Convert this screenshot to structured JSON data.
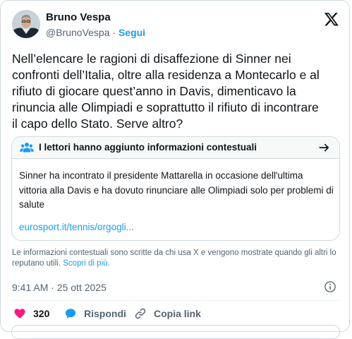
{
  "author": {
    "name": "Bruno Vespa",
    "handle": "@BrunoVespa",
    "separator": "·",
    "follow_label": "Segui"
  },
  "tweet": {
    "text": "Nell’elencare le ragioni di disaffezione di Sinner nei\nconfronti dell’Italia, oltre alla residenza a Montecarlo e al\nrifiuto di giocare quest’anno in Davis, dimenticavo la\nrinuncia alle Olimpiadi e soprattutto il rifiuto di incontrare\nil capo dello Stato. Serve altro?"
  },
  "community_note": {
    "title": "I lettori hanno aggiunto informazioni contestuali",
    "body": "Sinner ha incontrato il presidente Mattarella in occasione dell'ultima vittoria alla Davis e ha dovuto rinunciare alle Olimpiadi solo per problemi di salute",
    "link": "eurosport.it/tennis/orgogli..."
  },
  "disclaimer": {
    "text": "Le informazioni contestuali sono scritte da chi usa X e vengono mostrate quando gli altri lo reputano utili. ",
    "learn_more": "Scopri di più."
  },
  "meta": {
    "timestamp": "9:41 AM · 25 ott 2025"
  },
  "actions": {
    "like_count": "320",
    "reply_label": "Rispondi",
    "copy_label": "Copia link"
  },
  "icons": {
    "x_logo": "x-logo-icon",
    "people": "people-icon",
    "arrow": "arrow-right-icon",
    "info": "info-icon",
    "heart": "heart-icon",
    "reply": "chat-bubble-icon",
    "link": "link-icon"
  },
  "colors": {
    "accent": "#1d9bf0",
    "like": "#f91880",
    "text": "#0f1419",
    "muted": "#536471",
    "border": "#cfd9de"
  }
}
